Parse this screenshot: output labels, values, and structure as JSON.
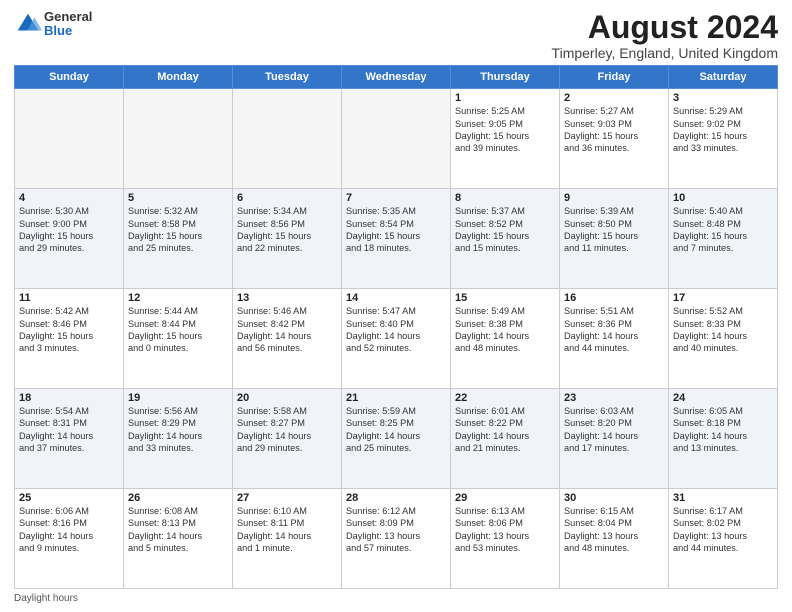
{
  "header": {
    "logo": {
      "general": "General",
      "blue": "Blue"
    },
    "title": "August 2024",
    "subtitle": "Timperley, England, United Kingdom"
  },
  "weekdays": [
    "Sunday",
    "Monday",
    "Tuesday",
    "Wednesday",
    "Thursday",
    "Friday",
    "Saturday"
  ],
  "weeks": [
    [
      {
        "day": "",
        "info": ""
      },
      {
        "day": "",
        "info": ""
      },
      {
        "day": "",
        "info": ""
      },
      {
        "day": "",
        "info": ""
      },
      {
        "day": "1",
        "info": "Sunrise: 5:25 AM\nSunset: 9:05 PM\nDaylight: 15 hours\nand 39 minutes."
      },
      {
        "day": "2",
        "info": "Sunrise: 5:27 AM\nSunset: 9:03 PM\nDaylight: 15 hours\nand 36 minutes."
      },
      {
        "day": "3",
        "info": "Sunrise: 5:29 AM\nSunset: 9:02 PM\nDaylight: 15 hours\nand 33 minutes."
      }
    ],
    [
      {
        "day": "4",
        "info": "Sunrise: 5:30 AM\nSunset: 9:00 PM\nDaylight: 15 hours\nand 29 minutes."
      },
      {
        "day": "5",
        "info": "Sunrise: 5:32 AM\nSunset: 8:58 PM\nDaylight: 15 hours\nand 25 minutes."
      },
      {
        "day": "6",
        "info": "Sunrise: 5:34 AM\nSunset: 8:56 PM\nDaylight: 15 hours\nand 22 minutes."
      },
      {
        "day": "7",
        "info": "Sunrise: 5:35 AM\nSunset: 8:54 PM\nDaylight: 15 hours\nand 18 minutes."
      },
      {
        "day": "8",
        "info": "Sunrise: 5:37 AM\nSunset: 8:52 PM\nDaylight: 15 hours\nand 15 minutes."
      },
      {
        "day": "9",
        "info": "Sunrise: 5:39 AM\nSunset: 8:50 PM\nDaylight: 15 hours\nand 11 minutes."
      },
      {
        "day": "10",
        "info": "Sunrise: 5:40 AM\nSunset: 8:48 PM\nDaylight: 15 hours\nand 7 minutes."
      }
    ],
    [
      {
        "day": "11",
        "info": "Sunrise: 5:42 AM\nSunset: 8:46 PM\nDaylight: 15 hours\nand 3 minutes."
      },
      {
        "day": "12",
        "info": "Sunrise: 5:44 AM\nSunset: 8:44 PM\nDaylight: 15 hours\nand 0 minutes."
      },
      {
        "day": "13",
        "info": "Sunrise: 5:46 AM\nSunset: 8:42 PM\nDaylight: 14 hours\nand 56 minutes."
      },
      {
        "day": "14",
        "info": "Sunrise: 5:47 AM\nSunset: 8:40 PM\nDaylight: 14 hours\nand 52 minutes."
      },
      {
        "day": "15",
        "info": "Sunrise: 5:49 AM\nSunset: 8:38 PM\nDaylight: 14 hours\nand 48 minutes."
      },
      {
        "day": "16",
        "info": "Sunrise: 5:51 AM\nSunset: 8:36 PM\nDaylight: 14 hours\nand 44 minutes."
      },
      {
        "day": "17",
        "info": "Sunrise: 5:52 AM\nSunset: 8:33 PM\nDaylight: 14 hours\nand 40 minutes."
      }
    ],
    [
      {
        "day": "18",
        "info": "Sunrise: 5:54 AM\nSunset: 8:31 PM\nDaylight: 14 hours\nand 37 minutes."
      },
      {
        "day": "19",
        "info": "Sunrise: 5:56 AM\nSunset: 8:29 PM\nDaylight: 14 hours\nand 33 minutes."
      },
      {
        "day": "20",
        "info": "Sunrise: 5:58 AM\nSunset: 8:27 PM\nDaylight: 14 hours\nand 29 minutes."
      },
      {
        "day": "21",
        "info": "Sunrise: 5:59 AM\nSunset: 8:25 PM\nDaylight: 14 hours\nand 25 minutes."
      },
      {
        "day": "22",
        "info": "Sunrise: 6:01 AM\nSunset: 8:22 PM\nDaylight: 14 hours\nand 21 minutes."
      },
      {
        "day": "23",
        "info": "Sunrise: 6:03 AM\nSunset: 8:20 PM\nDaylight: 14 hours\nand 17 minutes."
      },
      {
        "day": "24",
        "info": "Sunrise: 6:05 AM\nSunset: 8:18 PM\nDaylight: 14 hours\nand 13 minutes."
      }
    ],
    [
      {
        "day": "25",
        "info": "Sunrise: 6:06 AM\nSunset: 8:16 PM\nDaylight: 14 hours\nand 9 minutes."
      },
      {
        "day": "26",
        "info": "Sunrise: 6:08 AM\nSunset: 8:13 PM\nDaylight: 14 hours\nand 5 minutes."
      },
      {
        "day": "27",
        "info": "Sunrise: 6:10 AM\nSunset: 8:11 PM\nDaylight: 14 hours\nand 1 minute."
      },
      {
        "day": "28",
        "info": "Sunrise: 6:12 AM\nSunset: 8:09 PM\nDaylight: 13 hours\nand 57 minutes."
      },
      {
        "day": "29",
        "info": "Sunrise: 6:13 AM\nSunset: 8:06 PM\nDaylight: 13 hours\nand 53 minutes."
      },
      {
        "day": "30",
        "info": "Sunrise: 6:15 AM\nSunset: 8:04 PM\nDaylight: 13 hours\nand 48 minutes."
      },
      {
        "day": "31",
        "info": "Sunrise: 6:17 AM\nSunset: 8:02 PM\nDaylight: 13 hours\nand 44 minutes."
      }
    ]
  ],
  "footer": {
    "daylight_label": "Daylight hours"
  }
}
